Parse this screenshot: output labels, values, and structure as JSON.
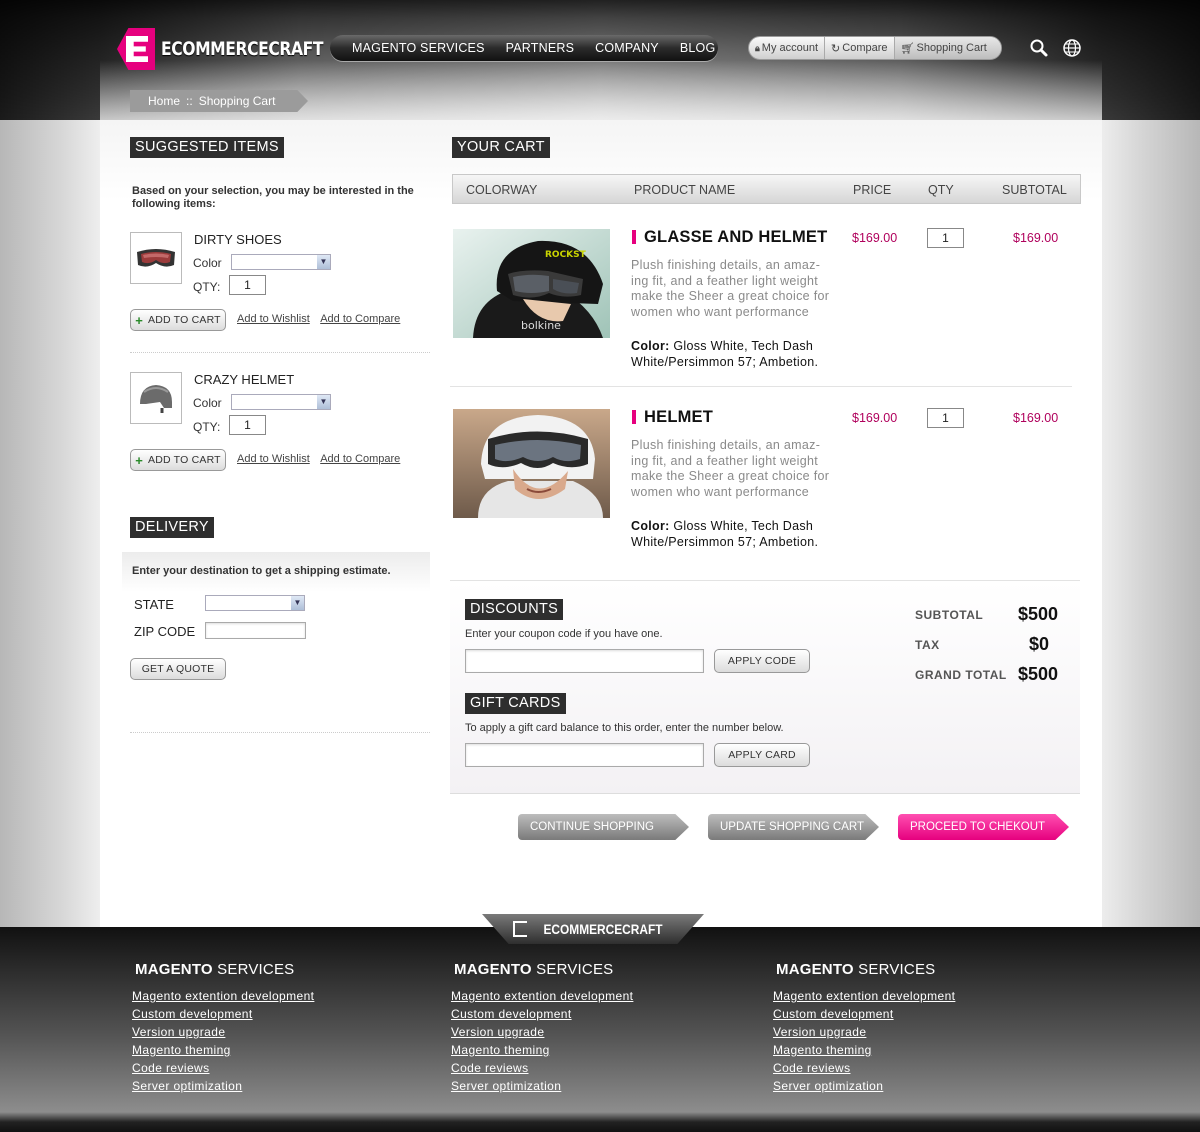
{
  "brand": {
    "name": "ECOMMERCECRAFT",
    "accent": "#e6007e"
  },
  "nav": {
    "items": [
      "MAGENTO SERVICES",
      "PARTNERS",
      "COMPANY",
      "BLOG"
    ]
  },
  "usernav": {
    "account": "My account",
    "compare": "Compare",
    "cart": "Shopping Cart"
  },
  "icons": {
    "search": "search-icon",
    "globe": "globe-icon"
  },
  "breadcrumb": {
    "home": "Home",
    "sep": "::",
    "current": "Shopping Cart"
  },
  "suggested": {
    "heading": "SUGGESTED ITEMS",
    "intro": "Based on your selection, you may be interested in the following items:",
    "color_label": "Color",
    "qty_label": "QTY:",
    "add_to_cart": "ADD TO CART",
    "wishlist": "Add to Wishlist",
    "compare": "Add to Compare",
    "items": [
      {
        "name": "DIRTY SHOES",
        "qty": "1"
      },
      {
        "name": "CRAZY HELMET",
        "qty": "1"
      }
    ]
  },
  "delivery": {
    "heading": "DELIVERY",
    "intro": "Enter your destination to get a shipping estimate.",
    "state_label": "STATE",
    "zip_label": "ZIP CODE",
    "quote_button": "GET A QUOTE"
  },
  "cart": {
    "heading": "YOUR CART",
    "columns": [
      "COLORWAY",
      "PRODUCT NAME",
      "PRICE",
      "QTY",
      "SUBTOTAL"
    ],
    "items": [
      {
        "name": "GLASSE AND HELMET",
        "desc": "Plush finishing details, an amaz-ing fit, and a feather light weight make the Sheer a great choice for women who want performance",
        "color_label": "Color:",
        "color": "Gloss White, Tech Dash White/Persimmon 57; Ambetion.",
        "price": "$169.00",
        "qty": "1",
        "subtotal": "$169.00"
      },
      {
        "name": "HELMET",
        "desc": "Plush finishing details, an amaz-ing fit, and a feather light weight make the Sheer a great choice for women who want performance",
        "color_label": "Color:",
        "color": "Gloss White, Tech Dash White/Persimmon 57; Ambetion.",
        "price": "$169.00",
        "qty": "1",
        "subtotal": "$169.00"
      }
    ]
  },
  "discounts": {
    "heading": "DISCOUNTS",
    "text": "Enter your coupon code if you have one.",
    "button": "APPLY CODE"
  },
  "giftcards": {
    "heading": "GIFT CARDS",
    "text": "To apply a gift card balance to this order, enter the number below.",
    "button": "APPLY CARD"
  },
  "totals": {
    "subtotal_label": "SUBTOTAL",
    "subtotal": "$500",
    "tax_label": "TAX",
    "tax": "$0",
    "grand_label": "GRAND TOTAL",
    "grand": "$500"
  },
  "actions": {
    "continue": "CONTINUE SHOPPING",
    "update": "UPDATE SHOPPING CART",
    "checkout": "PROCEED TO CHEKOUT"
  },
  "footer": {
    "logo": "ECOMMERCECRAFT",
    "columns": [
      {
        "title_bold": "MAGENTO",
        "title_rest": " SERVICES",
        "links": [
          "Magento extention development",
          "Custom development",
          "Version upgrade",
          "Magento theming",
          "Code reviews",
          "Server optimization"
        ]
      },
      {
        "title_bold": "MAGENTO",
        "title_rest": " SERVICES",
        "links": [
          "Magento extention development",
          "Custom development",
          "Version upgrade",
          "Magento theming",
          "Code reviews",
          "Server optimization"
        ]
      },
      {
        "title_bold": "MAGENTO",
        "title_rest": " SERVICES",
        "links": [
          "Magento extention development",
          "Custom development",
          "Version upgrade",
          "Magento theming",
          "Code reviews",
          "Server optimization"
        ]
      }
    ]
  }
}
